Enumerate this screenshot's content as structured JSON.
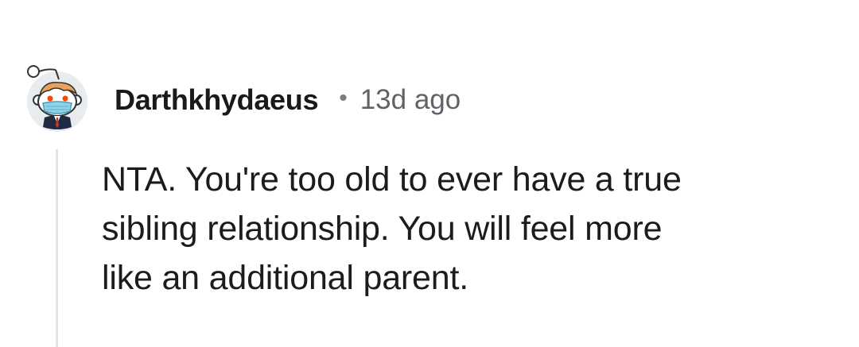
{
  "comment": {
    "author": "Darthkhydaeus",
    "separator": "•",
    "age": "13d ago",
    "avatar_icon": "snoo-avatar-icon",
    "body_lines": [
      "NTA. You're too old to ever have a true",
      "sibling relationship. You will feel more",
      "like an additional parent."
    ]
  },
  "colors": {
    "background": "#ffffff",
    "author_text": "#1a1a1b",
    "meta_text": "#5f6368",
    "body_text": "#1c1c1c",
    "thread_line": "#e4e4e4"
  }
}
